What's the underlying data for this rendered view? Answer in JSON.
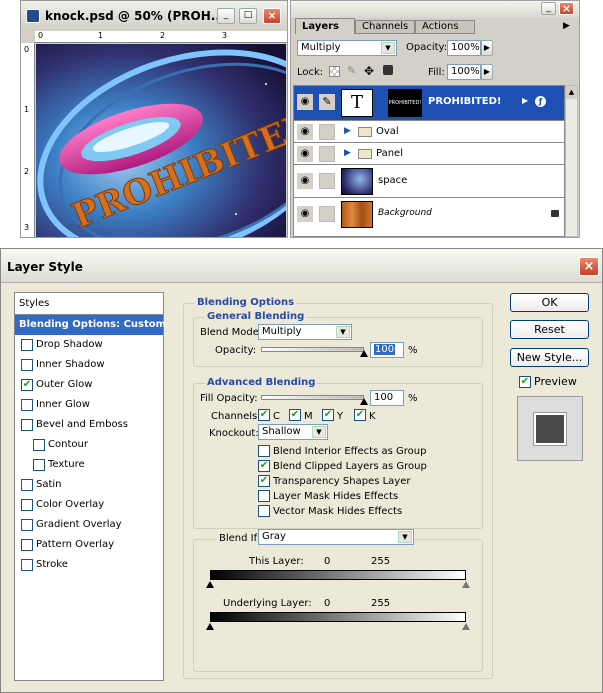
{
  "doc_window": {
    "title": "knock.psd @ 50% (PROH...",
    "min_btn": "_",
    "max_btn": "□",
    "close_btn": "×",
    "ruler_top": [
      "0",
      "1",
      "2",
      "3"
    ],
    "ruler_left": [
      "0",
      "1",
      "2",
      "3"
    ],
    "artwork_text": "PROHIBITED!"
  },
  "layers_panel": {
    "tabs": [
      "Layers",
      "Channels",
      "Actions"
    ],
    "blend_mode": "Multiply",
    "opacity_label": "Opacity:",
    "opacity_value": "100%",
    "lock_label": "Lock:",
    "fill_label": "Fill:",
    "fill_value": "100%",
    "text_thumb": "T",
    "layers": [
      {
        "name": "PROHIBITED!",
        "thumb_text": "PROHIBITED!"
      },
      {
        "name": "Oval"
      },
      {
        "name": "Panel"
      },
      {
        "name": "space"
      },
      {
        "name": "Background"
      }
    ]
  },
  "dialog": {
    "title": "Layer Style",
    "styles_header": "Styles",
    "style_items": [
      {
        "label": "Blending Options: Custom",
        "checkbox": false,
        "checked": false,
        "selected": true,
        "indent": false
      },
      {
        "label": "Drop Shadow",
        "checkbox": true,
        "checked": false,
        "indent": false
      },
      {
        "label": "Inner Shadow",
        "checkbox": true,
        "checked": false,
        "indent": false
      },
      {
        "label": "Outer Glow",
        "checkbox": true,
        "checked": true,
        "indent": false
      },
      {
        "label": "Inner Glow",
        "checkbox": true,
        "checked": false,
        "indent": false
      },
      {
        "label": "Bevel and Emboss",
        "checkbox": true,
        "checked": false,
        "indent": false
      },
      {
        "label": "Contour",
        "checkbox": true,
        "checked": false,
        "indent": true
      },
      {
        "label": "Texture",
        "checkbox": true,
        "checked": false,
        "indent": true
      },
      {
        "label": "Satin",
        "checkbox": true,
        "checked": false,
        "indent": false
      },
      {
        "label": "Color Overlay",
        "checkbox": true,
        "checked": false,
        "indent": false
      },
      {
        "label": "Gradient Overlay",
        "checkbox": true,
        "checked": false,
        "indent": false
      },
      {
        "label": "Pattern Overlay",
        "checkbox": true,
        "checked": false,
        "indent": false
      },
      {
        "label": "Stroke",
        "checkbox": true,
        "checked": false,
        "indent": false
      }
    ],
    "blending_options_title": "Blending Options",
    "general_blending_title": "General Blending",
    "blend_mode_label": "Blend Mode:",
    "blend_mode_value": "Multiply",
    "opacity_label": "Opacity:",
    "opacity_value": "100",
    "percent": "%",
    "advanced_blending_title": "Advanced Blending",
    "fill_opacity_label": "Fill Opacity:",
    "fill_opacity_value": "100",
    "channels_label": "Channels:",
    "channels": [
      "C",
      "M",
      "Y",
      "K"
    ],
    "knockout_label": "Knockout:",
    "knockout_value": "Shallow",
    "options": [
      {
        "label": "Blend Interior Effects as Group",
        "checked": false
      },
      {
        "label": "Blend Clipped Layers as Group",
        "checked": true
      },
      {
        "label": "Transparency Shapes Layer",
        "checked": true
      },
      {
        "label": "Layer Mask Hides Effects",
        "checked": false
      },
      {
        "label": "Vector Mask Hides Effects",
        "checked": false
      }
    ],
    "blend_if_label": "Blend If:",
    "blend_if_value": "Gray",
    "this_layer_label": "This Layer:",
    "this_layer_min": "0",
    "this_layer_max": "255",
    "underlying_layer_label": "Underlying Layer:",
    "underlying_min": "0",
    "underlying_max": "255",
    "ok_label": "OK",
    "reset_label": "Reset",
    "new_style_label": "New Style...",
    "preview_label": "Preview",
    "preview_checked": true,
    "opacity_slider_fraction": 1.0,
    "fill_slider_fraction": 1.0
  }
}
